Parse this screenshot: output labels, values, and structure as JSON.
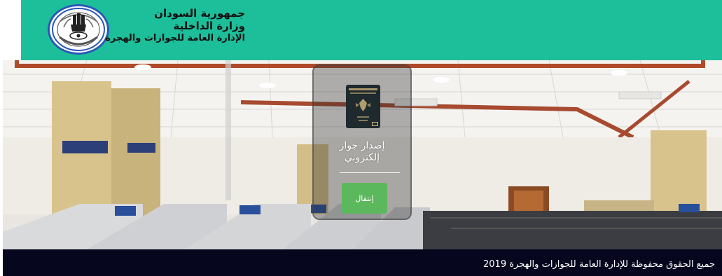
{
  "header": {
    "org_line1": "جمهورية السودان",
    "org_line2": "وزارة الداخلية",
    "org_line3": "الإدارة العامة للجوازات والهجرة",
    "background_color": "#1dbf9b",
    "logo_icon": "police-emblem-icon"
  },
  "card": {
    "passport_icon": "sudan-passport-icon",
    "title_line1": "إصدار جواز",
    "title_line2": "إلكتروني",
    "enter_label": "إنتقال",
    "button_color": "#5cb85c"
  },
  "footer": {
    "copyright": "جميع الحقوق محفوظة للإدارة العامة للجوازات والهجرة 2019",
    "background_color": "#06061e"
  }
}
